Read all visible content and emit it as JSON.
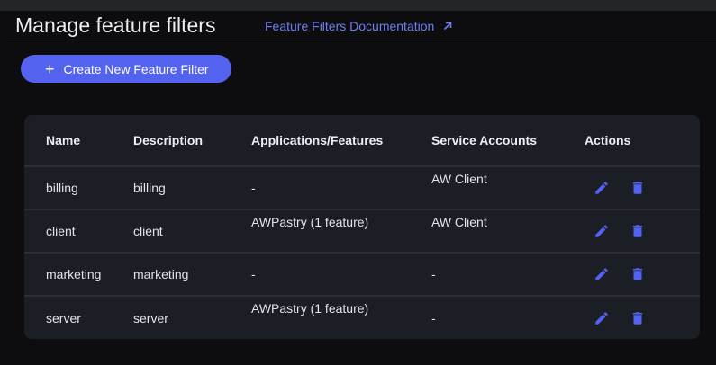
{
  "header": {
    "title": "Manage feature filters",
    "doc_link": "Feature Filters Documentation",
    "doc_link_icon": "arrow-up-right-icon"
  },
  "toolbar": {
    "create_label": "Create New Feature Filter",
    "create_icon": "plus-icon"
  },
  "colors": {
    "accent": "#5462f0",
    "link": "#6f7df5",
    "background": "#0d0d0f",
    "card": "#1b1e25"
  },
  "table": {
    "columns": [
      "Name",
      "Description",
      "Applications/Features",
      "Service Accounts",
      "Actions"
    ],
    "rows": [
      {
        "name": "billing",
        "description": "billing",
        "applications": "-",
        "service_accounts": "AW Client"
      },
      {
        "name": "client",
        "description": "client",
        "applications": "AWPastry (1 feature)",
        "service_accounts": "AW Client"
      },
      {
        "name": "marketing",
        "description": "marketing",
        "applications": "-",
        "service_accounts": "-"
      },
      {
        "name": "server",
        "description": "server",
        "applications": "AWPastry (1 feature)",
        "service_accounts": "-"
      }
    ]
  }
}
